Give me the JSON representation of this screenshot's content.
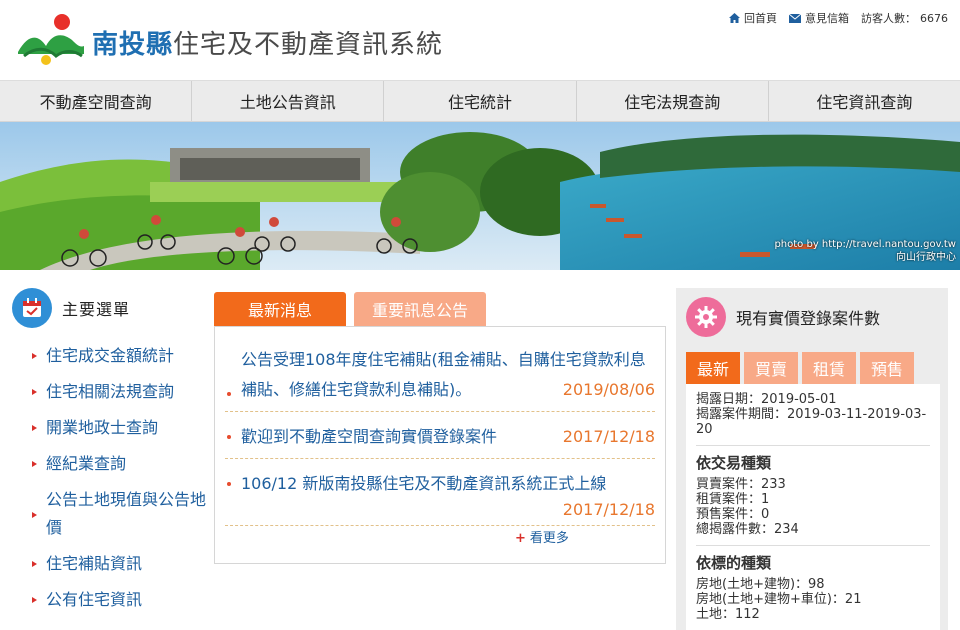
{
  "header": {
    "county_name": "南投縣",
    "system_name": "住宅及不動產資訊系統",
    "links": {
      "home_label": "回首頁",
      "feedback_label": "意見信箱",
      "visitors_label": "訪客人數：",
      "visitors_count": "6676"
    }
  },
  "nav": {
    "items": [
      {
        "label": "不動產空間查詢"
      },
      {
        "label": "土地公告資訊"
      },
      {
        "label": "住宅統計"
      },
      {
        "label": "住宅法規查詢"
      },
      {
        "label": "住宅資訊查詢"
      }
    ]
  },
  "banner": {
    "credit_line1": "photo by http://travel.nantou.gov.tw",
    "credit_line2": "向山行政中心"
  },
  "main_menu": {
    "title": "主要選單",
    "items": [
      {
        "label": "住宅成交金額統計"
      },
      {
        "label": "住宅相關法規查詢"
      },
      {
        "label": "開業地政士查詢"
      },
      {
        "label": "經紀業查詢"
      },
      {
        "label": "公告土地現值與公告地價"
      },
      {
        "label": "住宅補貼資訊"
      },
      {
        "label": "公有住宅資訊"
      }
    ]
  },
  "news": {
    "tabs": [
      {
        "label": "最新消息"
      },
      {
        "label": "重要訊息公告"
      }
    ],
    "items": [
      {
        "text": "公告受理108年度住宅補貼(租金補貼、自購住宅貸款利息補貼、修繕住宅貸款利息補貼)。",
        "date": "2019/08/06"
      },
      {
        "text": "歡迎到不動產空間查詢實價登錄案件",
        "date": "2017/12/18"
      },
      {
        "text": "106/12 新版南投縣住宅及不動產資訊系統正式上線",
        "date": "2017/12/18"
      }
    ],
    "more_label": "看更多"
  },
  "stats": {
    "title": "現有實價登錄案件數",
    "tabs": [
      {
        "label": "最新"
      },
      {
        "label": "買賣"
      },
      {
        "label": "租賃"
      },
      {
        "label": "預售"
      }
    ],
    "disclosure_date": "揭露日期：2019-05-01",
    "disclosure_period": "揭露案件期間：2019-03-11-2019-03-20",
    "by_type_title": "依交易種類",
    "by_type": [
      {
        "label": "買賣案件：233"
      },
      {
        "label": "租賃案件：1"
      },
      {
        "label": "預售案件：0"
      },
      {
        "label": "總揭露件數：234"
      }
    ],
    "by_target_title": "依標的種類",
    "by_target": [
      {
        "label": "房地(土地+建物)：98"
      },
      {
        "label": "房地(土地+建物+車位)：21"
      },
      {
        "label": "土地：112"
      }
    ]
  },
  "colors": {
    "accent_orange": "#f26a1b",
    "light_orange": "#f8a987",
    "link_blue": "#1f5f9e",
    "date_orange": "#e8772e"
  }
}
